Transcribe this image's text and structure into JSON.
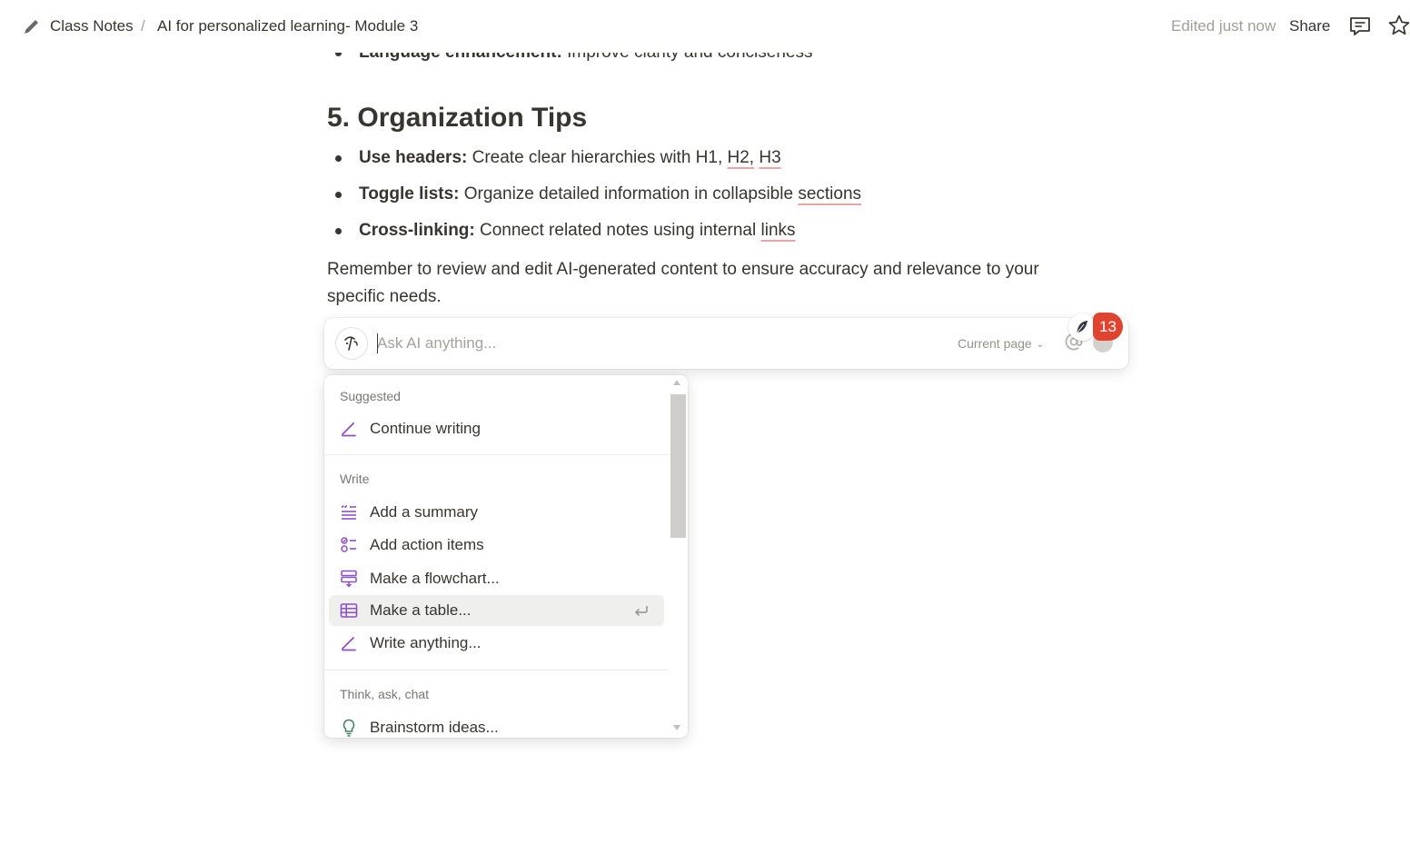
{
  "breadcrumb": {
    "items": [
      "Class Notes",
      "AI for personalized learning- Module 3"
    ],
    "separator": "/"
  },
  "header": {
    "edited": "Edited just now",
    "share": "Share"
  },
  "document": {
    "top_bullet": {
      "bold": "Language enhancement:",
      "text": " Improve clarity and conciseness"
    },
    "heading": "5. Organization Tips",
    "bullets": [
      {
        "bold": "Use headers:",
        "text": " Create clear hierarchies with H1, ",
        "flagged": [
          "H2,",
          "H3"
        ]
      },
      {
        "bold": "Toggle lists:",
        "text": " Organize detailed information in collapsible ",
        "flagged": [
          "sections"
        ]
      },
      {
        "bold": "Cross-linking:",
        "text": " Connect related notes using internal ",
        "flagged": [
          "links"
        ]
      }
    ],
    "paragraph": "Remember to review and edit AI-generated content to ensure accuracy and relevance to your specific needs."
  },
  "ai_bar": {
    "placeholder": "Ask AI anything...",
    "scope": "Current page",
    "badge_count": "13"
  },
  "menu": {
    "sections": [
      {
        "title": "Suggested",
        "items": [
          {
            "label": "Continue writing",
            "icon": "pen-icon"
          }
        ]
      },
      {
        "title": "Write",
        "items": [
          {
            "label": "Add a summary",
            "icon": "summary-icon"
          },
          {
            "label": "Add action items",
            "icon": "checklist-icon"
          },
          {
            "label": "Make a flowchart...",
            "icon": "flowchart-icon"
          },
          {
            "label": "Make a table...",
            "icon": "table-icon",
            "selected": true
          },
          {
            "label": "Write anything...",
            "icon": "pen-icon"
          }
        ]
      },
      {
        "title": "Think, ask, chat",
        "items": [
          {
            "label": "Brainstorm ideas...",
            "icon": "lightbulb-icon"
          }
        ]
      }
    ]
  },
  "colors": {
    "text": "#37352f",
    "muted": "#a09e98",
    "accent_purple": "#8e4ec6",
    "brainstorm_green": "#448361",
    "badge_red": "#e0442f",
    "spell_underline": "#e8a5a5",
    "selected_row": "#efefee"
  }
}
